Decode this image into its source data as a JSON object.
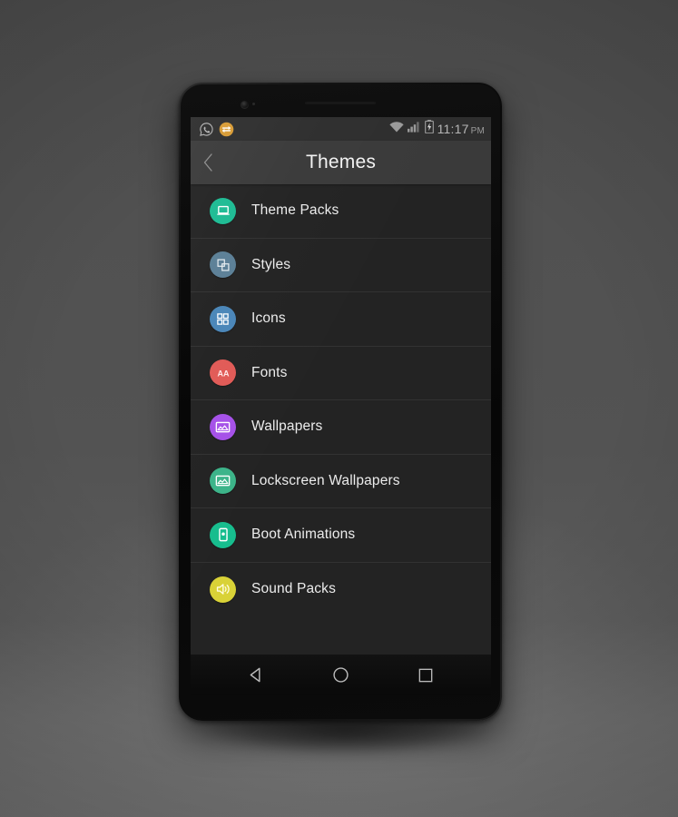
{
  "theme": {
    "backdrop_color": "#545454",
    "screen_bg": "#1c1c1c",
    "list_bg": "#232323",
    "actionbar_bg": "#3a3a3a",
    "statusbar_bg": "#2e2e2e",
    "divider_color": "#323232",
    "text_primary": "#ececec",
    "text_status": "#9a9a9a"
  },
  "statusbar": {
    "left_icons": [
      {
        "name": "whatsapp-icon",
        "label": "WhatsApp"
      },
      {
        "name": "sync-icon",
        "label": "Sync",
        "color": "#d89b34"
      }
    ],
    "right_icons": [
      {
        "name": "wifi-icon",
        "label": "Wi-Fi"
      },
      {
        "name": "signal-icon",
        "label": "Cellular signal"
      },
      {
        "name": "battery-charging-icon",
        "label": "Battery charging"
      }
    ],
    "time": "11:17",
    "ampm": "PM"
  },
  "actionbar": {
    "back_label": "Back",
    "title": "Themes"
  },
  "list": {
    "items": [
      {
        "label": "Theme Packs",
        "icon": "laptop-icon",
        "color": "#1cbb93"
      },
      {
        "label": "Styles",
        "icon": "layers-icon",
        "color": "#5b7f96"
      },
      {
        "label": "Icons",
        "icon": "grid-icon",
        "color": "#4a86b8"
      },
      {
        "label": "Fonts",
        "icon": "font-aa-icon",
        "color": "#e15b57"
      },
      {
        "label": "Wallpapers",
        "icon": "image-icon",
        "color": "#a551e8"
      },
      {
        "label": "Lockscreen Wallpapers",
        "icon": "image-icon",
        "color": "#3cb489"
      },
      {
        "label": "Boot Animations",
        "icon": "phone-device-icon",
        "color": "#17bd8e"
      },
      {
        "label": "Sound Packs",
        "icon": "speaker-icon",
        "color": "#d9d237"
      }
    ]
  },
  "navbar": {
    "buttons": [
      {
        "name": "back-nav-button",
        "label": "Back"
      },
      {
        "name": "home-nav-button",
        "label": "Home"
      },
      {
        "name": "recents-nav-button",
        "label": "Recents"
      }
    ]
  }
}
